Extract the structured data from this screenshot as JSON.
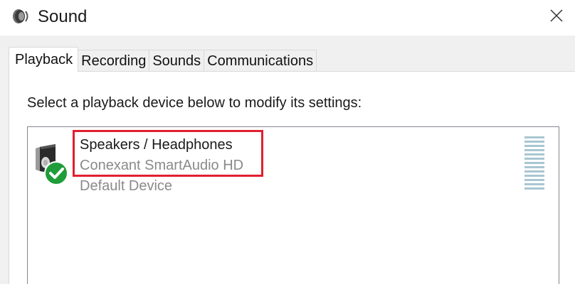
{
  "window": {
    "title": "Sound",
    "close_icon": "close-icon"
  },
  "tabs": [
    {
      "label": "Playback",
      "active": true
    },
    {
      "label": "Recording",
      "active": false
    },
    {
      "label": "Sounds",
      "active": false
    },
    {
      "label": "Communications",
      "active": false
    }
  ],
  "playback": {
    "instruction": "Select a playback device below to modify its settings:",
    "devices": [
      {
        "name": "Speakers / Headphones",
        "driver": "Conexant SmartAudio HD",
        "status": "Default Device",
        "icon": "speaker-icon",
        "badge_icon": "checkmark-icon",
        "highlighted": true,
        "level_meter_bars": 13
      }
    ]
  },
  "colors": {
    "highlight": "#e0202e",
    "default_badge": "#1f9d3a",
    "meter": "#a9c6d2",
    "secondary_text": "#8a8a8a"
  }
}
